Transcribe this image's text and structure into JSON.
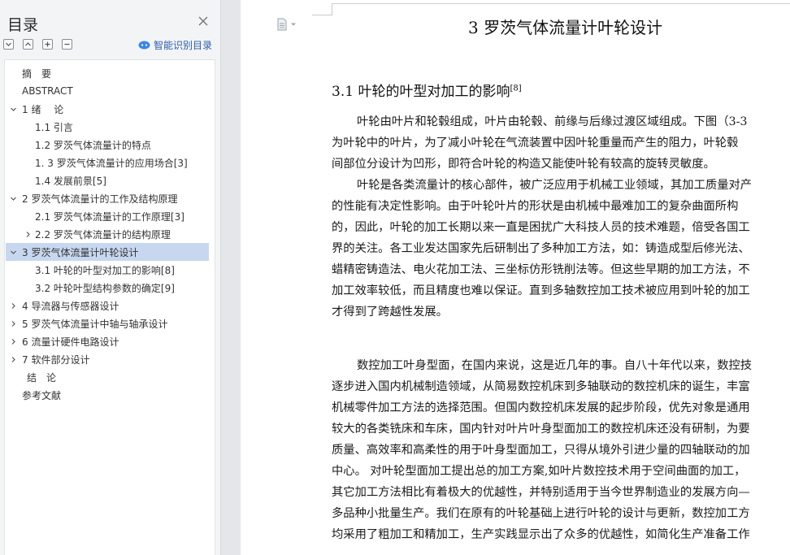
{
  "sidebar": {
    "title": "目录",
    "smart_toc_label": "智能识别目录",
    "items": [
      {
        "label": "摘　要",
        "level": 0,
        "chevron": "none"
      },
      {
        "label": "ABSTRACT",
        "level": 0,
        "chevron": "none"
      },
      {
        "label": "1 绪　 论",
        "level": 0,
        "chevron": "down"
      },
      {
        "label": "1.1  引言",
        "level": 1,
        "chevron": "none"
      },
      {
        "label": "1.2  罗茨气体流量计的特点",
        "level": 1,
        "chevron": "none"
      },
      {
        "label": "1. 3 罗茨气体流量计的应用场合[3]",
        "level": 1,
        "chevron": "none"
      },
      {
        "label": "1.4  发展前景[5]",
        "level": 1,
        "chevron": "none"
      },
      {
        "label": "2 罗茨气体流量计的工作及结构原理",
        "level": 0,
        "chevron": "down"
      },
      {
        "label": "2.1  罗茨气体流量计的工作原理[3]",
        "level": 1,
        "chevron": "none"
      },
      {
        "label": "2.2 罗茨气体流量计的结构原理",
        "level": 1,
        "chevron": "right"
      },
      {
        "label": "3 罗茨气体流量计叶轮设计",
        "level": 0,
        "chevron": "down",
        "selected": true
      },
      {
        "label": "3.1 叶轮的叶型对加工的影响[8]",
        "level": 1,
        "chevron": "none"
      },
      {
        "label": "3.2 叶轮叶型结构参数的确定[9]",
        "level": 1,
        "chevron": "none"
      },
      {
        "label": "4  导流器与传感器设计",
        "level": 0,
        "chevron": "right"
      },
      {
        "label": "5  罗茨气体流量计中轴与轴承设计",
        "level": 0,
        "chevron": "right"
      },
      {
        "label": "6 流量计硬件电路设计",
        "level": 0,
        "chevron": "right"
      },
      {
        "label": "7  软件部分设计",
        "level": 0,
        "chevron": "right"
      },
      {
        "label": "结　论",
        "level": 0,
        "chevron": "none",
        "extra_indent": true
      },
      {
        "label": "参考文献",
        "level": 0,
        "chevron": "none"
      }
    ]
  },
  "document": {
    "chapter_title": "3 罗茨气体流量计叶轮设计",
    "section_title": "3.1 叶轮的叶型对加工的影响",
    "section_ref": "[8]",
    "lines": [
      {
        "text": "叶轮由叶片和轮毂组成，叶片由轮毂、前缘与后缘过渡区域组成。下图（3-3",
        "indent": true
      },
      {
        "text": "为叶轮中的叶片，为了减小叶轮在气流装置中因叶轮重量而产生的阻力，叶轮毂",
        "indent": false
      },
      {
        "text": "间部位分设计为凹形，即符合叶轮的构造又能使叶轮有较高的旋转灵敏度。",
        "indent": false
      },
      {
        "text": "叶轮是各类流量计的核心部件，被广泛应用于机械工业领域，其加工质量对产",
        "indent": true
      },
      {
        "text": "的性能有决定性影响。由于叶轮叶片的形状是由机械中最难加工的复杂曲面所构",
        "indent": false
      },
      {
        "text": "的，因此，叶轮的加工长期以来一直是困扰广大科技人员的技术难题，倍受各国工",
        "indent": false
      },
      {
        "text": "界的关注。各工业发达国家先后研制出了多种加工方法，如：铸造成型后修光法、",
        "indent": false
      },
      {
        "text": "蜡精密铸造法、电火花加工法、三坐标仿形铣削法等。但这些早期的加工方法，不",
        "indent": false
      },
      {
        "text": "加工效率较低，而且精度也难以保证。直到多轴数控加工技术被应用到叶轮的加工",
        "indent": false
      },
      {
        "text": "才得到了跨越性发展。",
        "indent": false
      },
      {
        "text": "数控加工叶身型面，在国内来说，这是近几年的事。自八十年代以来，数控技",
        "indent": true
      },
      {
        "text": "逐步进入国内机械制造领域，从简易数控机床到多轴联动的数控机床的诞生，丰富",
        "indent": false
      },
      {
        "text": "机械零件加工方法的选择范围。但国内数控机床发展的起步阶段，优先对象是通用",
        "indent": false
      },
      {
        "text": "较大的各类铣床和车床，国内针对叶片叶身型面加工的数控机床还没有研制，为要",
        "indent": false
      },
      {
        "text": "质量、高效率和高柔性的用于叶身型面加工，只得从境外引进少量的四轴联动的加",
        "indent": false
      },
      {
        "text": "中心。 对叶轮型面加工提出总的加工方案,如叶片数控技术用于空间曲面的加工，",
        "indent": false
      },
      {
        "text": "其它加工方法相比有着极大的优越性，并特别适用于当今世界制造业的发展方向—",
        "indent": false
      },
      {
        "text": "多品种小批量生产。我们在原有的叶轮基础上进行叶轮的设计与更新，数控加工方",
        "indent": false
      },
      {
        "text": "均采用了粗加工和精加工，生产实践显示出了众多的优越性，如简化生产准备工作",
        "indent": false
      }
    ]
  }
}
